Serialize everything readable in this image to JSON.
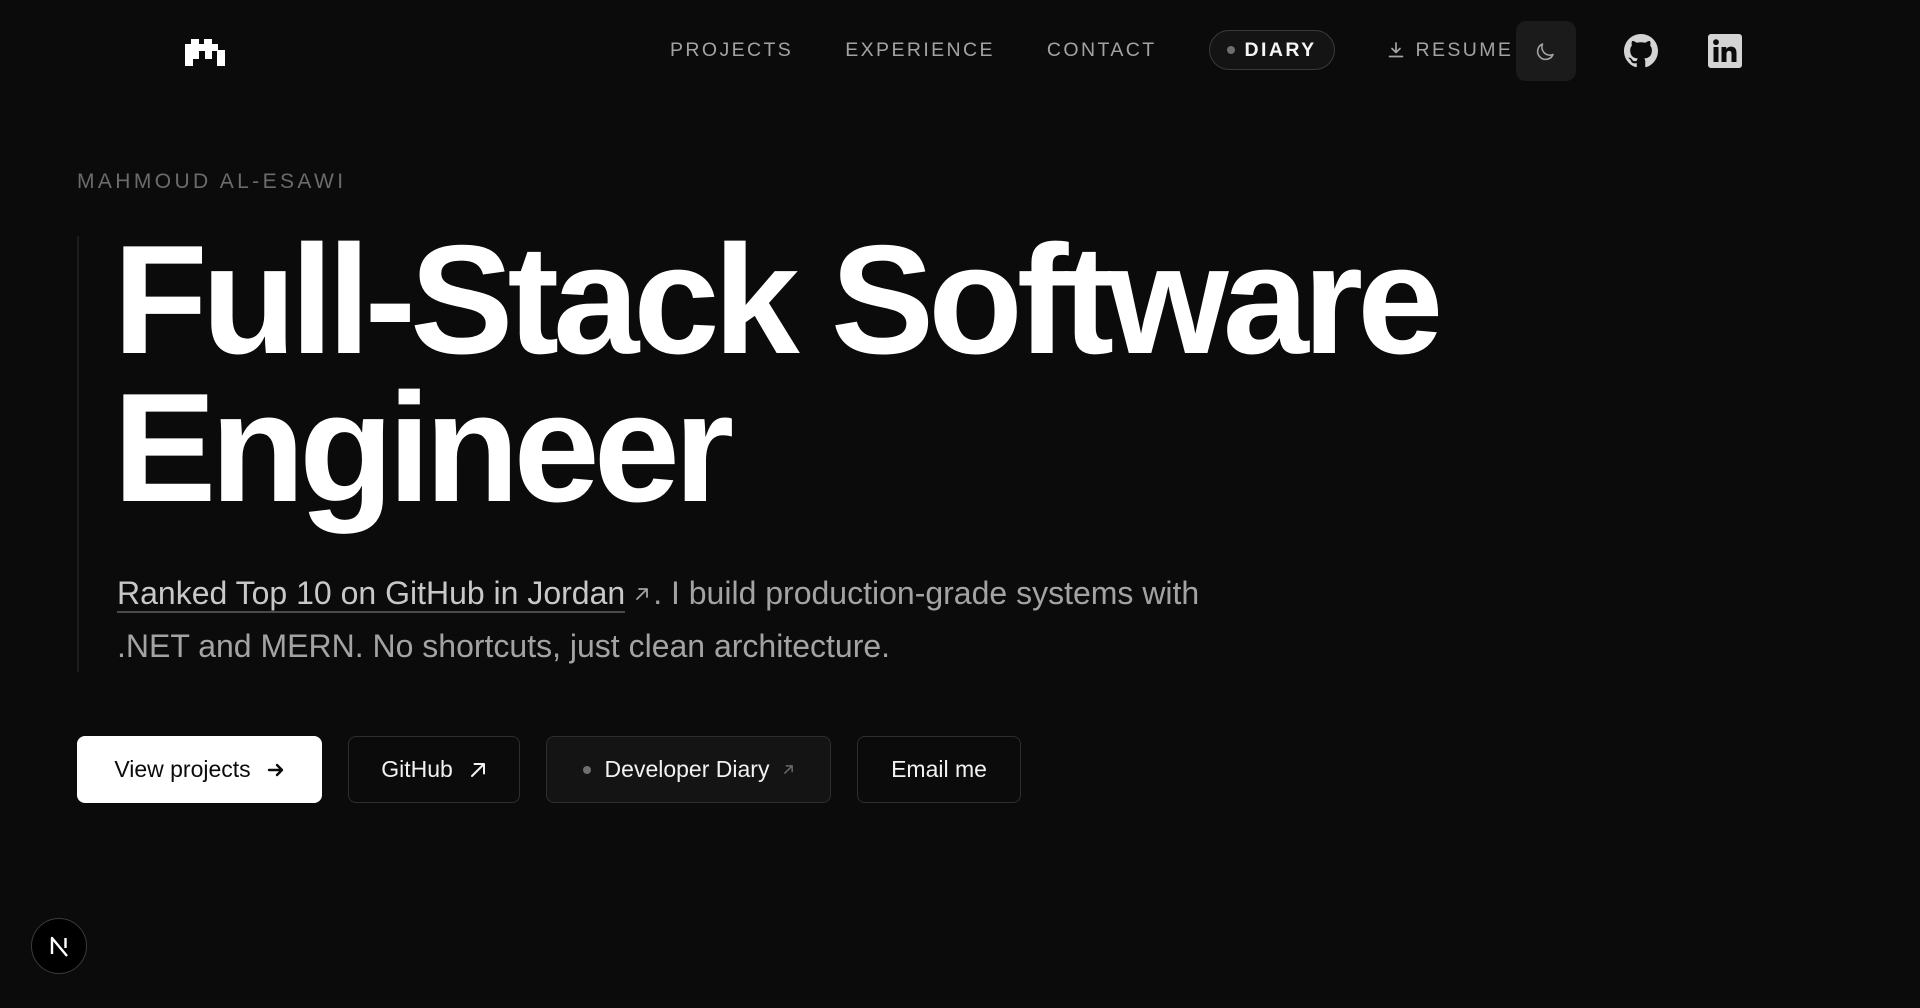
{
  "nav": {
    "links": {
      "projects": "PROJECTS",
      "experience": "EXPERIENCE",
      "contact": "CONTACT",
      "diary": "DIARY",
      "resume": "RESUME"
    }
  },
  "hero": {
    "eyebrow": "MAHMOUD AL-ESAWI",
    "headline_line1": "Full-Stack Software",
    "headline_line2": "Engineer",
    "subtitle_link": "Ranked Top 10 on GitHub in Jordan",
    "subtitle_rest": ". I build production-grade systems with .NET and MERN. No shortcuts, just clean architecture."
  },
  "buttons": {
    "view_projects": "View projects",
    "github": "GitHub",
    "developer_diary": "Developer Diary",
    "email": "Email me"
  },
  "icons": {
    "logo": "m-logo-icon",
    "theme": "moon-icon",
    "github": "github-icon",
    "linkedin": "linkedin-icon",
    "resume": "download-icon",
    "arrow_right": "arrow-right-icon",
    "arrow_up_right": "arrow-up-right-icon",
    "badge": "next-n-icon"
  },
  "colors": {
    "background": "#0b0b0b",
    "text_primary": "#ffffff",
    "text_muted": "#a3a3a3",
    "eyebrow": "#6b6b6b"
  }
}
